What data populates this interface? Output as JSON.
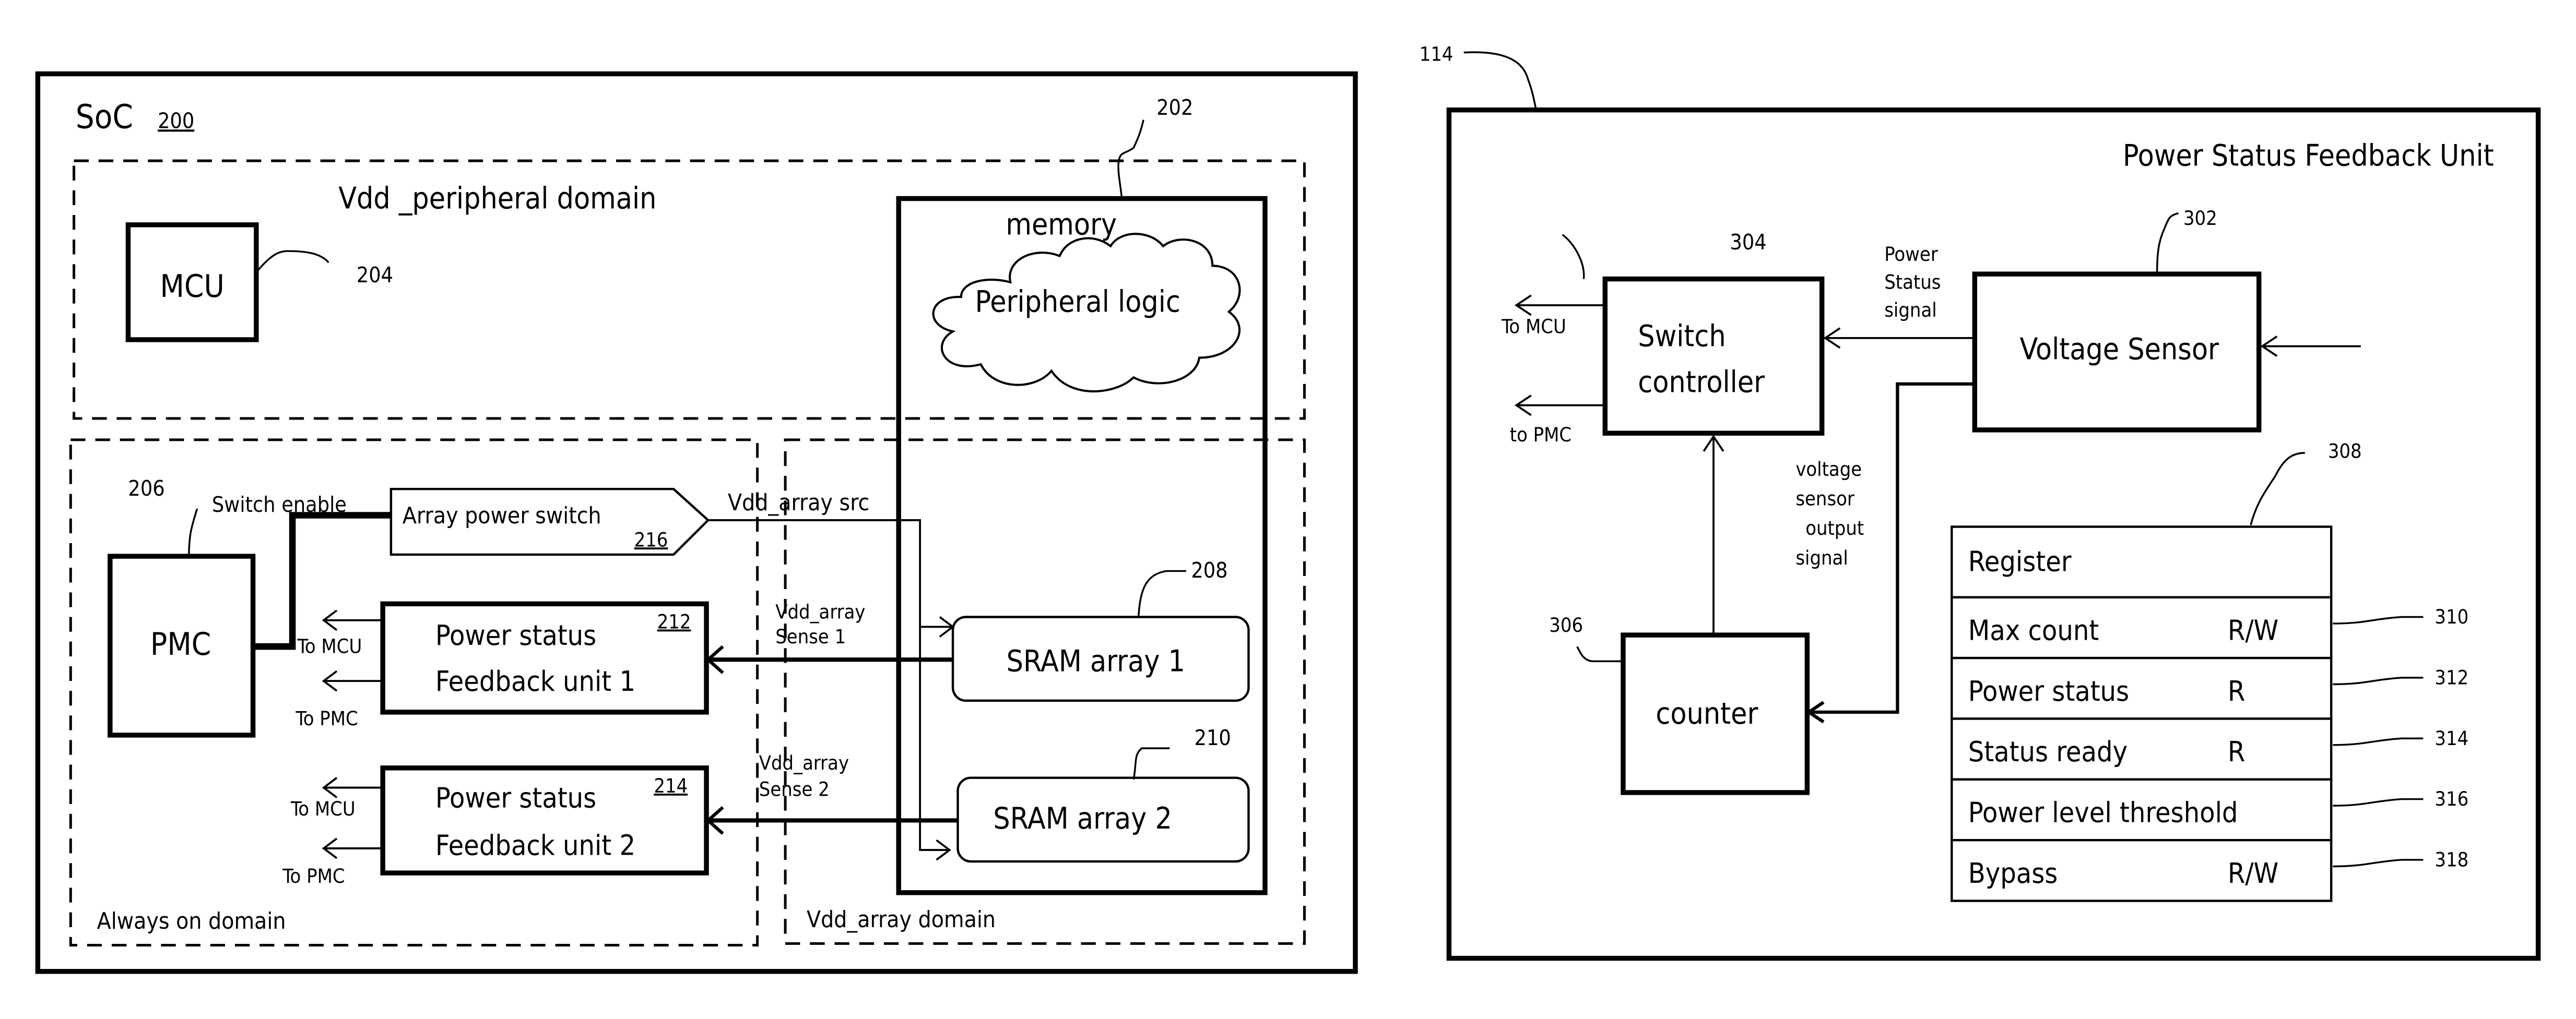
{
  "left_figure": {
    "soc_label": "SoC",
    "soc_ref": "200",
    "peripheral_domain_label": "Vdd _peripheral domain",
    "peripheral_domain_ref": "202",
    "memory_label": "memory",
    "peripheral_logic_label": "Peripheral logic",
    "mcu_label": "MCU",
    "mcu_ref": "204",
    "always_on_domain_label": "Always on domain",
    "pmc_label": "PMC",
    "pmc_ref": "206",
    "switch_enable_label": "Switch  enable",
    "array_power_switch_label": "Array power switch",
    "array_power_switch_ref": "216",
    "vdd_array_src_label": "Vdd_array src",
    "feedback_unit_1": {
      "line1": "Power status",
      "line2": "Feedback unit 1",
      "ref": "212",
      "to_mcu": "To MCU",
      "to_pmc": "To PMC",
      "sense_line1": "Vdd_array",
      "sense_line2": "Sense 1"
    },
    "feedback_unit_2": {
      "line1": "Power status",
      "line2": "Feedback unit 2",
      "ref": "214",
      "to_mcu": "To MCU",
      "to_pmc": "To PMC",
      "sense_line1": "Vdd_array",
      "sense_line2": "Sense 2"
    },
    "sram_array_1": {
      "label": "SRAM array 1",
      "ref": "208"
    },
    "sram_array_2": {
      "label": "SRAM array 2",
      "ref": "210"
    },
    "vdd_array_domain_label": "Vdd_array domain"
  },
  "right_figure": {
    "ref": "114",
    "title": "Power Status Feedback Unit",
    "voltage_sensor": {
      "label": "Voltage Sensor",
      "ref": "302"
    },
    "switch_controller": {
      "line1": "Switch",
      "line2": "controller",
      "ref": "304"
    },
    "counter": {
      "label": "counter",
      "ref": "306"
    },
    "to_mcu": "To MCU",
    "to_pmc": "to PMC",
    "power_status_signal": [
      "Power",
      "Status",
      "signal"
    ],
    "voltage_sensor_output_signal": [
      "voltage",
      "sensor",
      "output",
      "signal"
    ],
    "register": {
      "ref": "308",
      "header": "Register",
      "rows": [
        {
          "name": "Max count",
          "access": "R/W",
          "ref": "310"
        },
        {
          "name": "Power status",
          "access": "R",
          "ref": "312"
        },
        {
          "name": "Status ready",
          "access": "R",
          "ref": "314"
        },
        {
          "name": "Power level threshold",
          "access": "",
          "ref": "316"
        },
        {
          "name": "Bypass",
          "access": "R/W",
          "ref": "318"
        }
      ]
    }
  }
}
